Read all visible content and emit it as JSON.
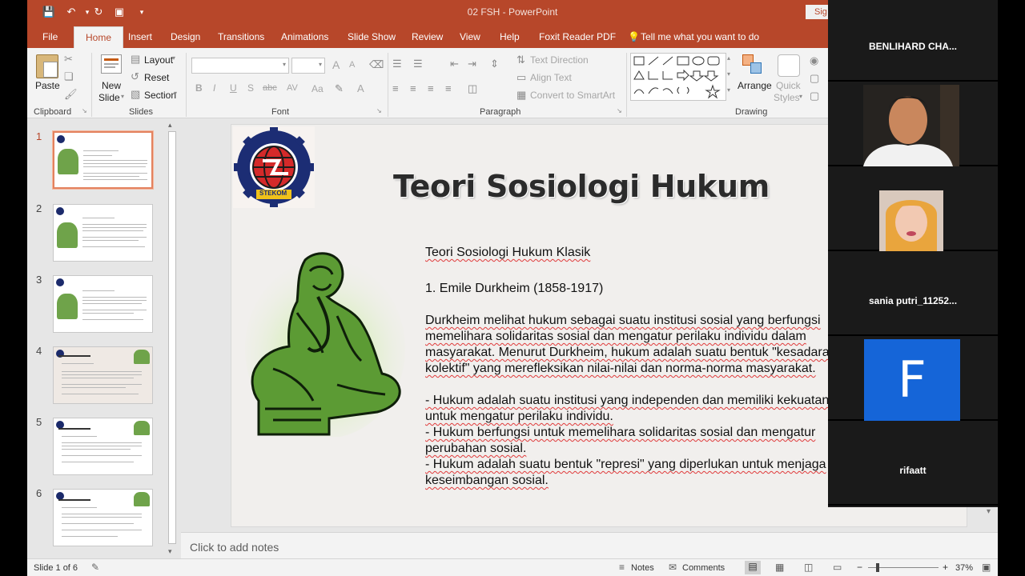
{
  "window": {
    "title": "02 FSH  -  PowerPoint",
    "signin": "Sig"
  },
  "tabs": [
    "File",
    "Home",
    "Insert",
    "Design",
    "Transitions",
    "Animations",
    "Slide Show",
    "Review",
    "View",
    "Help",
    "Foxit Reader PDF",
    "Tell me what you want to do"
  ],
  "ribbon": {
    "clipboard": {
      "paste": "Paste",
      "label": "Clipboard"
    },
    "slides": {
      "new_slide_1": "New",
      "new_slide_2": "Slide",
      "layout": "Layout",
      "reset": "Reset",
      "section": "Section",
      "label": "Slides"
    },
    "font": {
      "label": "Font",
      "bold": "B",
      "italic": "I",
      "underline": "U",
      "strike": "S",
      "abc": "abc",
      "spacing": "AV",
      "case": "Aa",
      "grow": "A",
      "shrink": "A"
    },
    "paragraph": {
      "label": "Paragraph",
      "text_direction": "Text Direction",
      "align_text": "Align Text",
      "convert_smartart": "Convert to SmartArt"
    },
    "drawing": {
      "label": "Drawing",
      "arrange": "Arrange",
      "quick_styles_1": "Quick",
      "quick_styles_2": "Styles"
    }
  },
  "thumbnails": [
    "1",
    "2",
    "3",
    "4",
    "5",
    "6"
  ],
  "slide": {
    "logo_text": "UNIVERSITAS SAINS & TEKNOLOGI KOMPUTER",
    "logo_brand": "STEKOM",
    "title": "Teori Sosiologi Hukum",
    "subtitle": "Teori Sosiologi Hukum Klasik",
    "item1": "1. Emile Durkheim (1858-1917)",
    "para": [
      "Durkheim melihat hukum sebagai suatu institusi sosial yang berfungsi",
      "memelihara solidaritas sosial dan mengatur perilaku individu dalam",
      "masyarakat. Menurut Durkheim, hukum adalah suatu bentuk \"kesadaran",
      "kolektif\" yang merefleksikan nilai-nilai dan norma-norma masyarakat."
    ],
    "bullets": [
      "- Hukum adalah suatu institusi yang independen dan memiliki kekuatan",
      "untuk mengatur perilaku individu.",
      "- Hukum berfungsi untuk memelihara solidaritas sosial dan mengatur",
      "perubahan sosial.",
      "- Hukum adalah suatu bentuk \"represi\" yang diperlukan untuk menjaga",
      "keseimbangan sosial."
    ]
  },
  "notes_placeholder": "Click to add notes",
  "status": {
    "slide_of": "Slide 1 of 6",
    "notes": "Notes",
    "comments": "Comments",
    "zoom": "37%",
    "minus": "−",
    "plus": "+"
  },
  "participants": [
    {
      "name": "BENLIHARD  CHA..."
    },
    {
      "name": ""
    },
    {
      "name": ""
    },
    {
      "name": "sania  putri_11252..."
    },
    {
      "name": "",
      "initial": "F",
      "initial_bg": "#1565d8"
    },
    {
      "name": "rifaatt"
    }
  ],
  "colors": {
    "accent": "#b7472a",
    "selected_thumb": "#e3825f"
  }
}
